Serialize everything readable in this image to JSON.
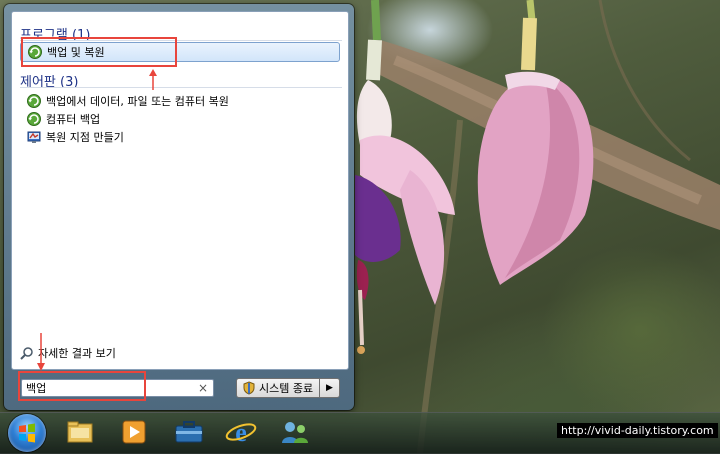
{
  "start_menu": {
    "groups": [
      {
        "header": "프로그램 (1)",
        "items": [
          {
            "label": "백업 및 복원",
            "icon": "backup-restore-icon"
          }
        ]
      },
      {
        "header": "제어판 (3)",
        "items": [
          {
            "label": "백업에서 데이터, 파일 또는 컴퓨터 복원",
            "icon": "backup-restore-icon"
          },
          {
            "label": "컴퓨터 백업",
            "icon": "backup-restore-icon"
          },
          {
            "label": "복원 지점 만들기",
            "icon": "system-restore-icon"
          }
        ]
      }
    ],
    "see_more": {
      "label": "자세한 결과 보기",
      "icon": "search-icon"
    },
    "search": {
      "value": "백업",
      "clear_icon": "clear-icon"
    },
    "shutdown": {
      "label": "시스템 종료",
      "icon": "shield-icon",
      "arrow": "▶"
    }
  },
  "taskbar": {
    "items": [
      "start-orb",
      "explorer-icon",
      "media-player-icon",
      "toolbox-icon",
      "internet-explorer-icon",
      "users-icon"
    ]
  },
  "watermark": "http://vivid-daily.tistory.com",
  "colors": {
    "highlight": "#e8453c",
    "group_header": "#1e3287",
    "selection_border": "#7da2ce"
  }
}
